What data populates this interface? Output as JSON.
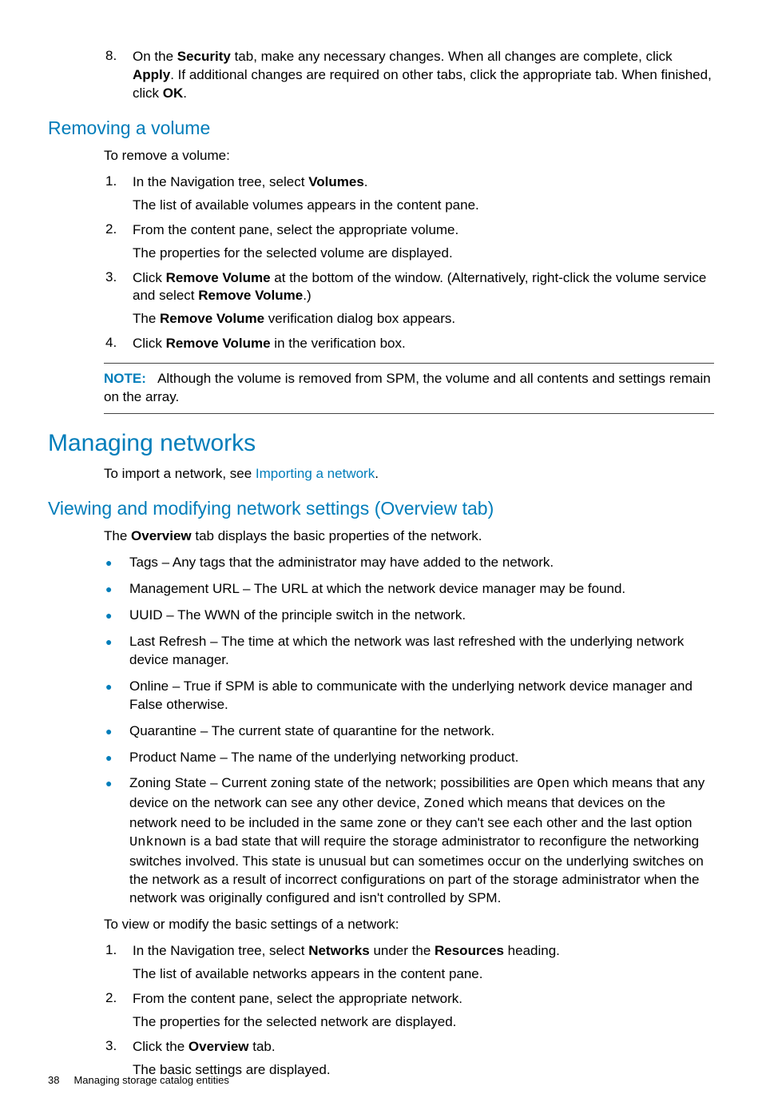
{
  "step8": {
    "num": "8.",
    "line1a": "On the ",
    "line1b": "Security",
    "line1c": " tab, make any necessary changes. When all changes are complete, click ",
    "line1d": "Apply",
    "line1e": ". If additional changes are required on other tabs, click the appropriate tab. When finished, click ",
    "line1f": "OK",
    "line1g": "."
  },
  "removing": {
    "heading": "Removing a volume",
    "intro": "To remove a volume:",
    "s1": {
      "num": "1.",
      "a": "In the Navigation tree, select ",
      "b": "Volumes",
      "c": ".",
      "p": "The list of available volumes appears in the content pane."
    },
    "s2": {
      "num": "2.",
      "a": "From the content pane, select the appropriate volume.",
      "p": "The properties for the selected volume are displayed."
    },
    "s3": {
      "num": "3.",
      "a": "Click ",
      "b": "Remove Volume",
      "c": " at the bottom of the window. (Alternatively, right-click the volume service and select ",
      "d": "Remove Volume",
      "e": ".)",
      "pA": "The ",
      "pB": "Remove Volume",
      "pC": " verification dialog box appears."
    },
    "s4": {
      "num": "4.",
      "a": "Click ",
      "b": "Remove Volume",
      "c": " in the verification box."
    },
    "note": {
      "label": "NOTE:",
      "text": "Although the volume is removed from SPM, the volume and all contents and settings remain on the array."
    }
  },
  "managing": {
    "heading": "Managing networks",
    "introA": "To import a network, see ",
    "introLink": "Importing a network",
    "introB": "."
  },
  "viewing": {
    "heading": "Viewing and modifying network settings (Overview tab)",
    "introA": "The ",
    "introB": "Overview",
    "introC": " tab displays the basic properties of the network.",
    "bullets": {
      "b1": "Tags – Any tags that the administrator may have added to the network.",
      "b2": "Management URL – The URL at which the network device manager may be found.",
      "b3": "UUID – The WWN of the principle switch in the network.",
      "b4": "Last Refresh – The time at which the network was last refreshed with the underlying network device manager.",
      "b5": "Online – True if SPM is able to communicate with the underlying network device manager and False otherwise.",
      "b6": "Quarantine – The current state of quarantine for the network.",
      "b7": "Product Name – The name of the underlying networking product.",
      "b8a": "Zoning State – Current zoning state of the network; possibilities are ",
      "b8open": "Open",
      "b8b": " which means that any device on the network can see any other device, ",
      "b8zoned": "Zoned",
      "b8c": " which means that devices on the network need to be included in the same zone or they can't see each other and the last option ",
      "b8unknown": "Unknown",
      "b8d": " is a bad state that will require the storage administrator to reconfigure the networking switches involved. This state is unusual but can sometimes occur on the underlying switches on the network as a result of incorrect configurations on part of the storage administrator when the network was originally configured and isn't controlled by SPM."
    },
    "intro2": "To view or modify the basic settings of a network:",
    "s1": {
      "num": "1.",
      "a": "In the Navigation tree, select ",
      "b": "Networks",
      "c": " under the ",
      "d": "Resources",
      "e": " heading.",
      "p": "The list of available networks appears in the content pane."
    },
    "s2": {
      "num": "2.",
      "a": "From the content pane, select the appropriate network.",
      "p": "The properties for the selected network are displayed."
    },
    "s3": {
      "num": "3.",
      "a": "Click the ",
      "b": "Overview",
      "c": " tab.",
      "p": "The basic settings are displayed."
    }
  },
  "footer": {
    "page": "38",
    "title": "Managing storage catalog entities"
  }
}
